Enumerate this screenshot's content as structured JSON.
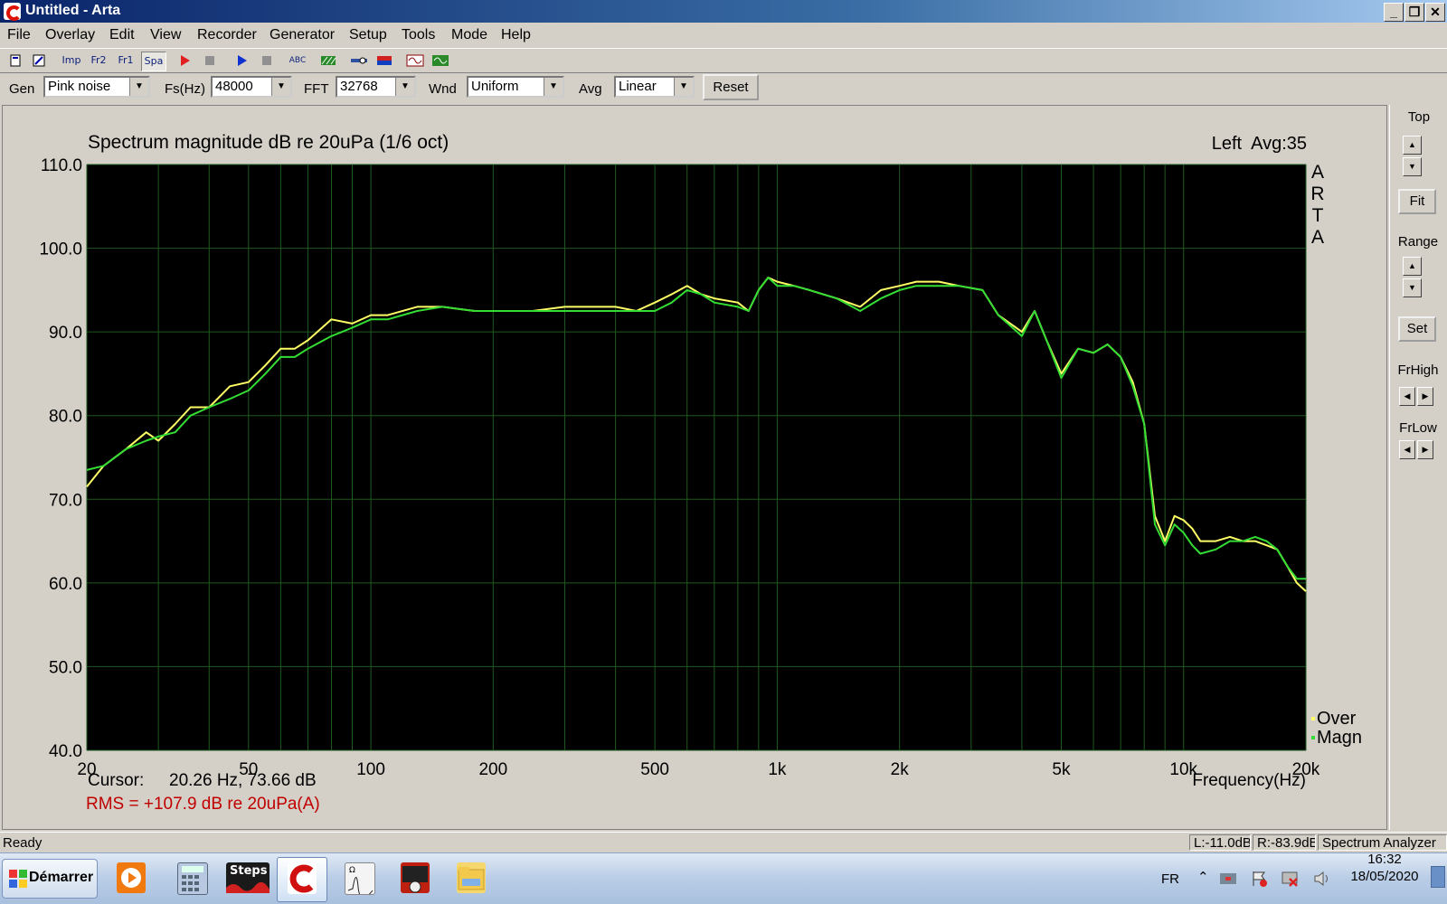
{
  "window": {
    "title": "Untitled - Arta",
    "min_label": "_",
    "max_label": "❐",
    "close_label": "✕"
  },
  "menu": [
    "File",
    "Overlay",
    "Edit",
    "View",
    "Recorder",
    "Generator",
    "Setup",
    "Tools",
    "Mode",
    "Help"
  ],
  "toolbar": {
    "imp": "Imp",
    "fr2": "Fr2",
    "fr1": "Fr1",
    "spa": "Spa",
    "abc": "ABC"
  },
  "controls": {
    "gen_label": "Gen",
    "gen_value": "Pink noise",
    "fs_label": "Fs(Hz)",
    "fs_value": "48000",
    "fft_label": "FFT",
    "fft_value": "32768",
    "wnd_label": "Wnd",
    "wnd_value": "Uniform",
    "avg_label": "Avg",
    "avg_value": "Linear",
    "reset_label": "Reset"
  },
  "right_panel": {
    "top_label": "Top",
    "fit_label": "Fit",
    "range_label": "Range",
    "set_label": "Set",
    "frhigh_label": "FrHigh",
    "frlow_label": "FrLow"
  },
  "plot": {
    "title": "Spectrum magnitude dB re 20uPa (1/6 oct)",
    "channel_info": "Left  Avg:35",
    "brand": [
      "A",
      "R",
      "T",
      "A"
    ],
    "cursor_label": "Cursor:",
    "cursor_value": "20.26 Hz, 73.66 dB",
    "rms": "RMS = +107.9 dB re 20uPa(A)",
    "xlabel": "Frequency(Hz)"
  },
  "chart_data": {
    "type": "line",
    "title": "Spectrum magnitude dB re 20uPa (1/6 oct)",
    "xlabel": "Frequency(Hz)",
    "ylabel": "",
    "xscale": "log",
    "xlim": [
      20,
      20000
    ],
    "ylim": [
      40,
      110
    ],
    "grid": true,
    "legend": "bottom-right",
    "y_ticks": [
      "110.0",
      "100.0",
      "90.0",
      "80.0",
      "70.0",
      "60.0",
      "50.0",
      "40.0"
    ],
    "y_tick_values": [
      110,
      100,
      90,
      80,
      70,
      60,
      50,
      40
    ],
    "x_ticks": [
      "20",
      "50",
      "100",
      "200",
      "500",
      "1k",
      "2k",
      "5k",
      "10k",
      "20k"
    ],
    "x_tick_values": [
      20,
      50,
      100,
      200,
      500,
      1000,
      2000,
      5000,
      10000,
      20000
    ],
    "series": [
      {
        "name": "Over",
        "color": "#ffff66",
        "x": [
          20,
          22,
          25,
          28,
          30,
          33,
          36,
          40,
          45,
          50,
          55,
          60,
          65,
          70,
          80,
          90,
          100,
          110,
          130,
          150,
          180,
          200,
          250,
          300,
          350,
          400,
          450,
          500,
          550,
          600,
          650,
          700,
          800,
          850,
          900,
          950,
          1000,
          1100,
          1200,
          1400,
          1600,
          1800,
          2000,
          2200,
          2500,
          2800,
          3200,
          3500,
          4000,
          4300,
          4600,
          5000,
          5500,
          6000,
          6500,
          7000,
          7500,
          8000,
          8500,
          9000,
          9500,
          10000,
          10500,
          11000,
          12000,
          13000,
          14000,
          15000,
          16000,
          17000,
          18000,
          19000,
          20000
        ],
        "y": [
          71.5,
          74,
          76,
          78,
          77,
          79,
          81,
          81,
          83.5,
          84,
          86,
          88,
          88,
          89,
          91.5,
          91,
          92,
          92,
          93,
          93,
          92.5,
          92.5,
          92.5,
          93,
          93,
          93,
          92.5,
          93.5,
          94.5,
          95.5,
          94.5,
          94,
          93.5,
          92.5,
          95,
          96.5,
          96,
          95.5,
          95,
          94,
          93,
          95,
          95.5,
          96,
          96,
          95.5,
          95,
          92,
          90,
          92.5,
          89,
          85,
          88,
          87.5,
          88.5,
          87,
          84,
          79,
          68,
          65,
          68,
          67.5,
          66.5,
          65,
          65,
          65.5,
          65,
          65,
          64.5,
          64,
          62,
          60,
          59
        ]
      },
      {
        "name": "Magn",
        "color": "#33dd33",
        "x": [
          20,
          22,
          25,
          28,
          30,
          33,
          36,
          40,
          45,
          50,
          55,
          60,
          65,
          70,
          80,
          90,
          100,
          110,
          130,
          150,
          180,
          200,
          250,
          300,
          350,
          400,
          450,
          500,
          550,
          600,
          650,
          700,
          800,
          850,
          900,
          950,
          1000,
          1100,
          1200,
          1400,
          1600,
          1800,
          2000,
          2200,
          2500,
          2800,
          3200,
          3500,
          4000,
          4300,
          4600,
          5000,
          5500,
          6000,
          6500,
          7000,
          7500,
          8000,
          8500,
          9000,
          9500,
          10000,
          10500,
          11000,
          12000,
          13000,
          14000,
          15000,
          16000,
          17000,
          18000,
          19000,
          20000
        ],
        "y": [
          73.5,
          74,
          76,
          77,
          77.5,
          78,
          80,
          81,
          82,
          83,
          85,
          87,
          87,
          88,
          89.5,
          90.5,
          91.5,
          91.5,
          92.5,
          93,
          92.5,
          92.5,
          92.5,
          92.5,
          92.5,
          92.5,
          92.5,
          92.5,
          93.5,
          95,
          94.5,
          93.5,
          93,
          92.5,
          95,
          96.5,
          95.5,
          95.5,
          95,
          94,
          92.5,
          94,
          95,
          95.5,
          95.5,
          95.5,
          95,
          92,
          89.5,
          92.5,
          89,
          84.5,
          88,
          87.5,
          88.5,
          87,
          83.5,
          79,
          67,
          64.5,
          67,
          66,
          64.5,
          63.5,
          64,
          65,
          65,
          65.5,
          65,
          64,
          62,
          60.5,
          60.5
        ]
      }
    ]
  },
  "status": {
    "left": "Ready",
    "l_level": "L:-11.0dB",
    "r_level": "R:-83.9dB",
    "mode": "Spectrum Analyzer"
  },
  "taskbar": {
    "start_label": "Démarrer",
    "steps_label": "Steps",
    "lang": "FR",
    "time": "16:32",
    "date": "18/05/2020"
  }
}
